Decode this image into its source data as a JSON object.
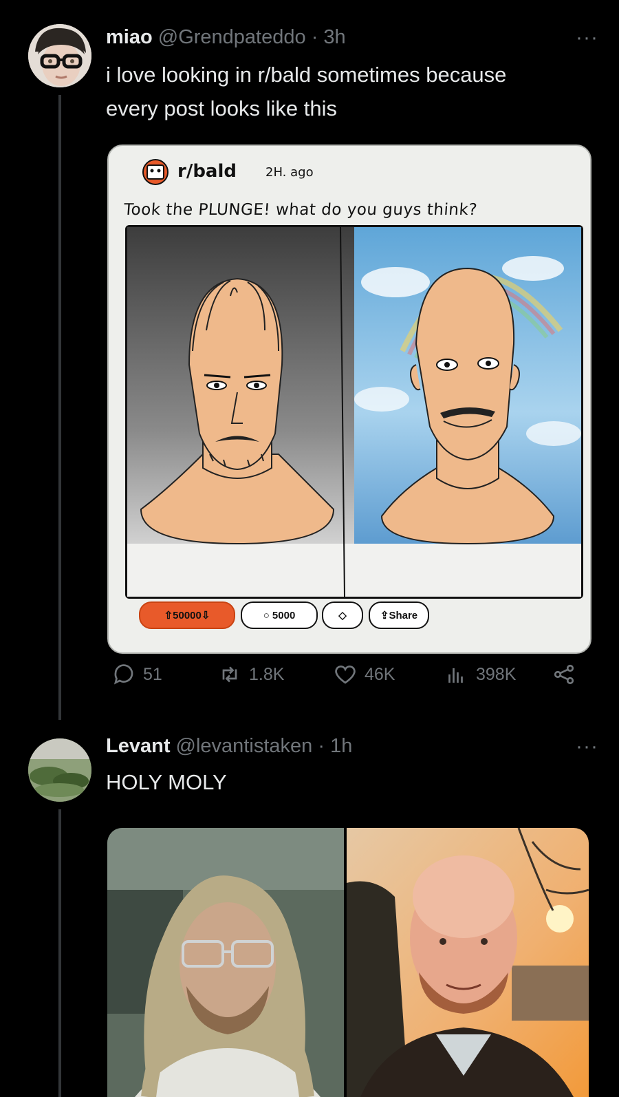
{
  "tweet1": {
    "display_name": "miao",
    "handle": "@Grendpateddo",
    "separator": "·",
    "time": "3h",
    "more": "···",
    "text_line1": "i love looking in r/bald sometimes because",
    "text_line2": "every post looks like this",
    "card": {
      "subreddit": "r/bald",
      "age": "2H. ago",
      "title": "Took the PLUNGE! what do you guys think?",
      "votes": "50000",
      "comments": "5000",
      "share": "Share"
    },
    "stats": {
      "replies": "51",
      "reposts": "1.8K",
      "likes": "46K",
      "views": "398K"
    }
  },
  "tweet2": {
    "display_name": "Levant",
    "handle": "@levantistaken",
    "separator": "·",
    "time": "1h",
    "more": "···",
    "text": "HOLY MOLY"
  },
  "colors": {
    "background": "#000000",
    "text": "#e7e9ea",
    "secondary": "#71767b",
    "reddit_orange": "#e85a2a"
  }
}
